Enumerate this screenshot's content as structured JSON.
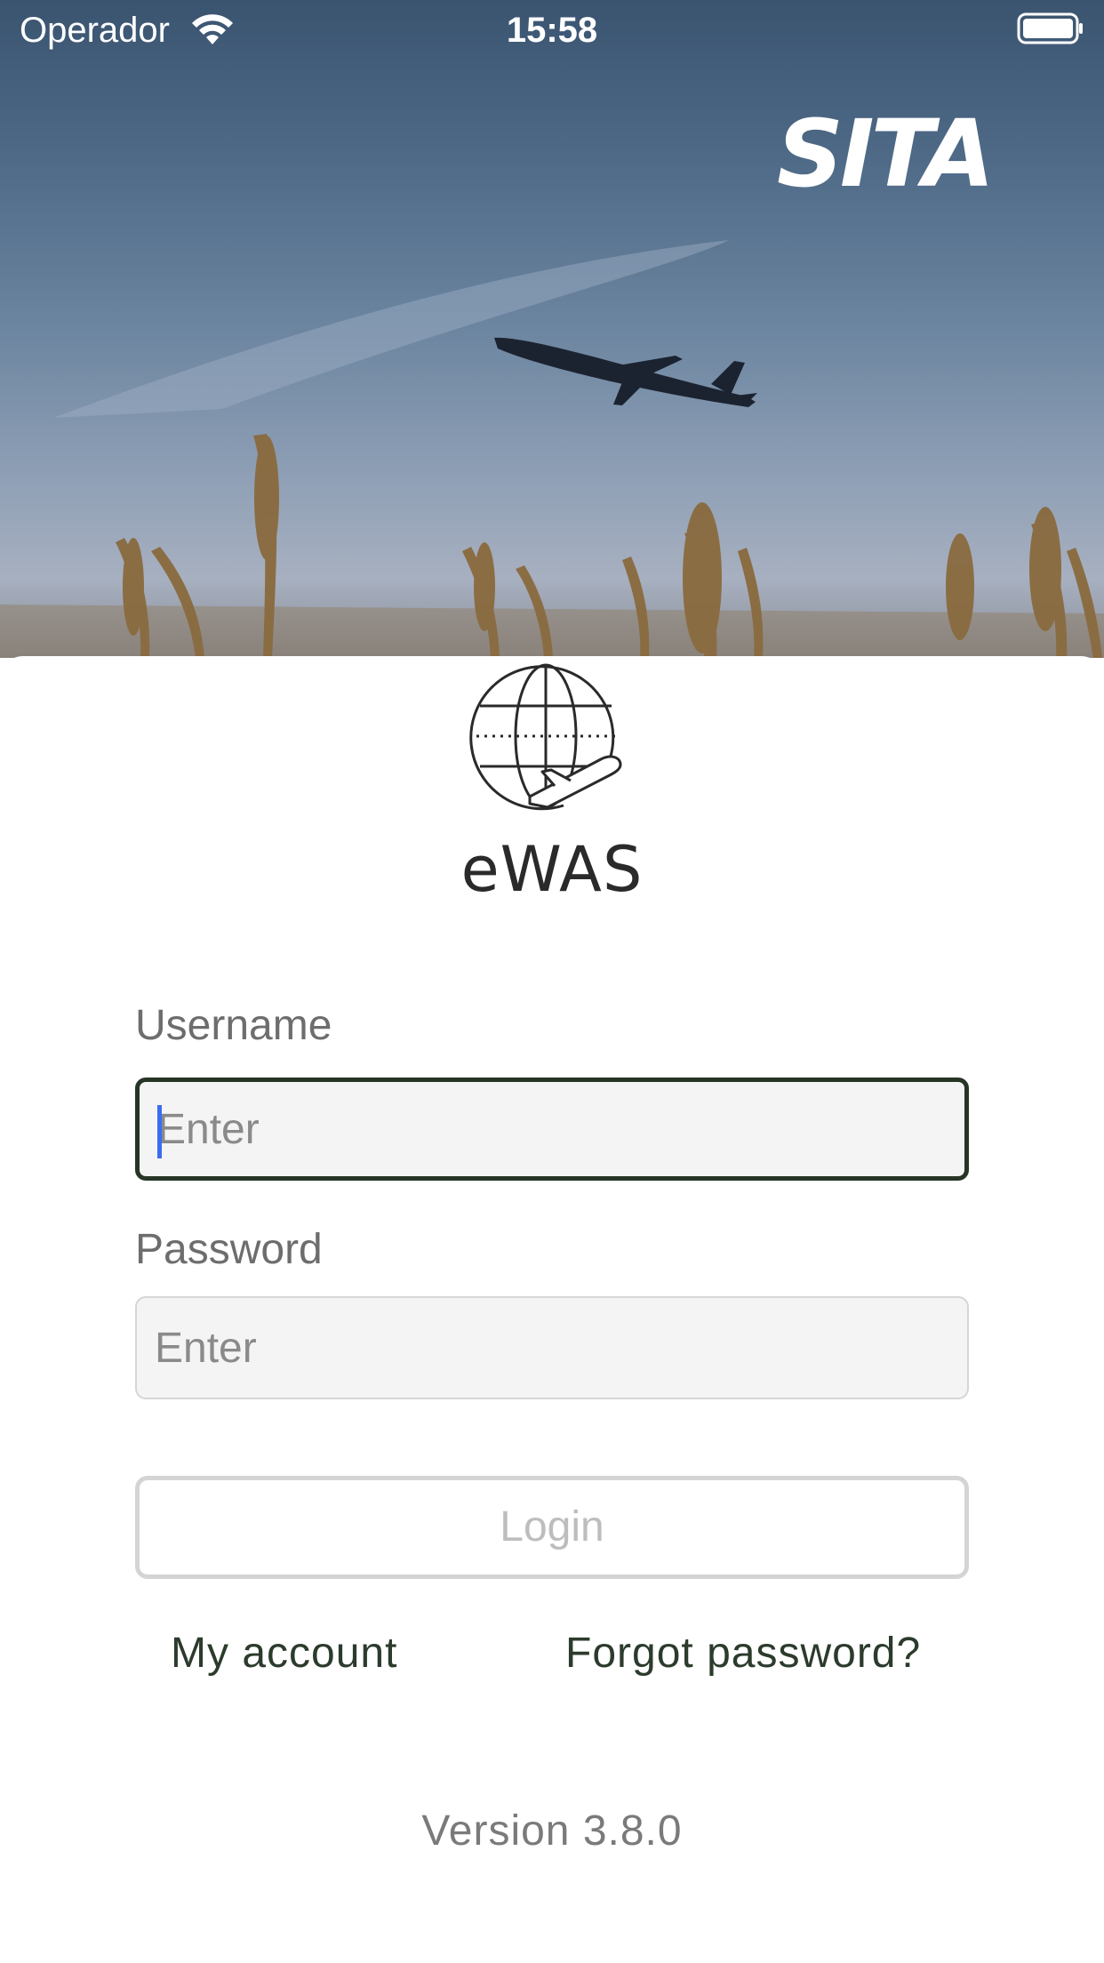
{
  "status_bar": {
    "carrier": "Operador",
    "time": "15:58"
  },
  "hero": {
    "brand_logo": "SITA"
  },
  "app": {
    "name": "eWAS"
  },
  "form": {
    "username_label": "Username",
    "username_placeholder": "Enter",
    "username_value": "",
    "password_label": "Password",
    "password_placeholder": "Enter",
    "password_value": "",
    "login_label": "Login"
  },
  "links": {
    "my_account": "My account",
    "forgot_password": "Forgot password?"
  },
  "footer": {
    "version": "Version 3.8.0"
  },
  "icons": {
    "wifi": "wifi-icon",
    "battery": "battery-icon",
    "app": "globe-plane-icon"
  },
  "colors": {
    "focus_border": "#263526",
    "link_text": "#2c3b2c",
    "caret": "#3b6cf0",
    "disabled_text": "#bdbdbd"
  }
}
